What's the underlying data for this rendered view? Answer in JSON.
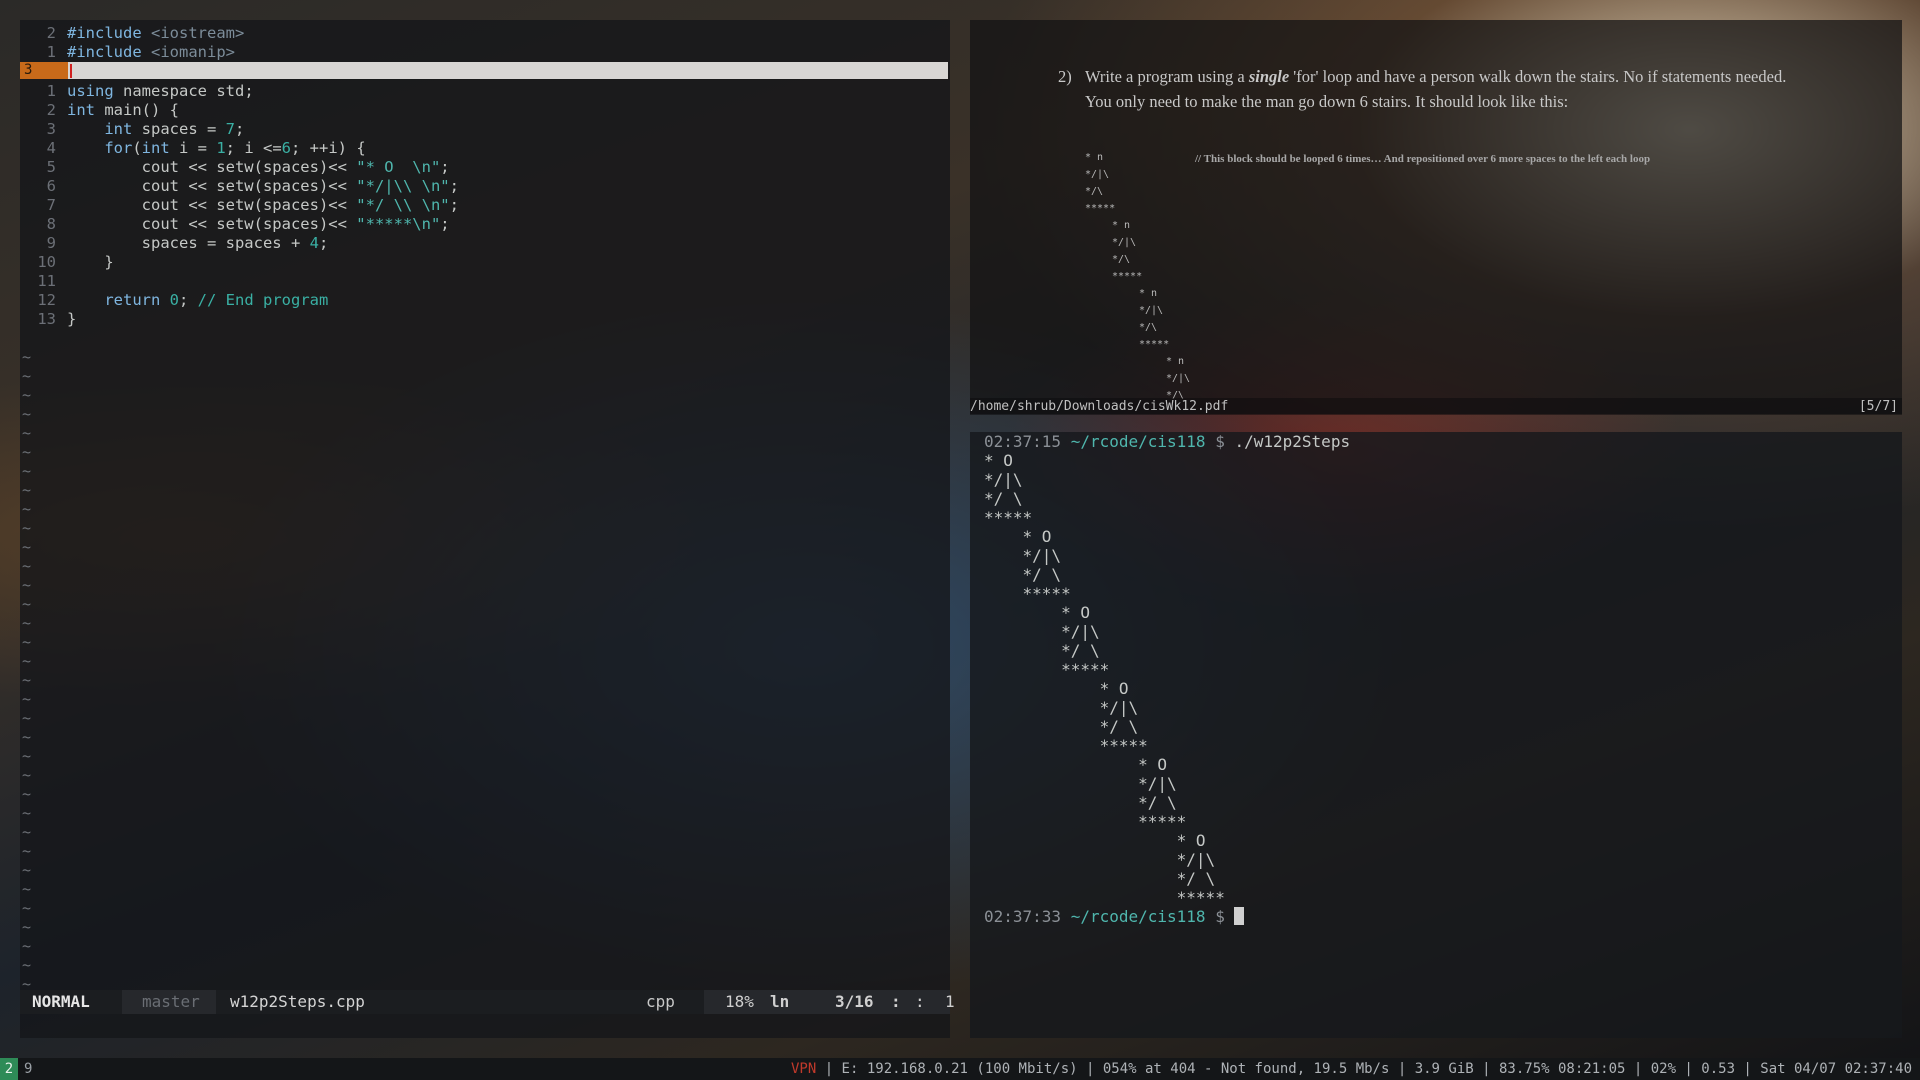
{
  "editor": {
    "tilde": "~",
    "lines": [
      {
        "num": "2",
        "parts": [
          [
            "inc-kw",
            "#include "
          ],
          [
            "inc",
            "<iostream>"
          ]
        ]
      },
      {
        "num": "1",
        "parts": [
          [
            "inc-kw",
            "#include "
          ],
          [
            "inc",
            "<iomanip>"
          ]
        ]
      },
      {
        "num": "3",
        "parts": []
      },
      {
        "num": "1",
        "parts": [
          [
            "kw",
            "using "
          ],
          [
            "plain",
            "namespace std;"
          ]
        ]
      },
      {
        "num": "2",
        "parts": [
          [
            "type",
            "int "
          ],
          [
            "plain",
            "main() {"
          ]
        ]
      },
      {
        "num": "3",
        "parts": [
          [
            "plain",
            "    "
          ],
          [
            "type",
            "int "
          ],
          [
            "plain",
            "spaces = "
          ],
          [
            "num",
            "7"
          ],
          [
            "plain",
            ";"
          ]
        ]
      },
      {
        "num": "4",
        "parts": [
          [
            "plain",
            "    "
          ],
          [
            "kw",
            "for"
          ],
          [
            "plain",
            "("
          ],
          [
            "type",
            "int "
          ],
          [
            "plain",
            "i = "
          ],
          [
            "num",
            "1"
          ],
          [
            "plain",
            "; i <="
          ],
          [
            "num",
            "6"
          ],
          [
            "plain",
            "; ++i) {"
          ]
        ]
      },
      {
        "num": "5",
        "parts": [
          [
            "plain",
            "        cout << setw(spaces)<< "
          ],
          [
            "str",
            "\"* O  \\n\""
          ],
          [
            "plain",
            ";"
          ]
        ]
      },
      {
        "num": "6",
        "parts": [
          [
            "plain",
            "        cout << setw(spaces)<< "
          ],
          [
            "str",
            "\"*/|\\\\ \\n\""
          ],
          [
            "plain",
            ";"
          ]
        ]
      },
      {
        "num": "7",
        "parts": [
          [
            "plain",
            "        cout << setw(spaces)<< "
          ],
          [
            "str",
            "\"*/ \\\\ \\n\""
          ],
          [
            "plain",
            ";"
          ]
        ]
      },
      {
        "num": "8",
        "parts": [
          [
            "plain",
            "        cout << setw(spaces)<< "
          ],
          [
            "str",
            "\"*****\\n\""
          ],
          [
            "plain",
            ";"
          ]
        ]
      },
      {
        "num": "9",
        "parts": [
          [
            "plain",
            "        spaces = spaces + "
          ],
          [
            "num",
            "4"
          ],
          [
            "plain",
            ";"
          ]
        ]
      },
      {
        "num": "10",
        "parts": [
          [
            "plain",
            "    }"
          ]
        ]
      },
      {
        "num": "11",
        "parts": []
      },
      {
        "num": "12",
        "parts": [
          [
            "plain",
            "    "
          ],
          [
            "kw",
            "return "
          ],
          [
            "num",
            "0"
          ],
          [
            "plain",
            "; "
          ],
          [
            "com",
            "// End program"
          ]
        ]
      },
      {
        "num": "13",
        "parts": [
          [
            "plain",
            "}"
          ]
        ]
      }
    ],
    "status": {
      "mode": "NORMAL",
      "branch": "master",
      "filename": "w12p2Steps.cpp",
      "filetype": "cpp",
      "percent": "18%",
      "ln": "ln",
      "position": "3/16",
      "sep1": ":",
      "sep2": ":",
      "col": "1"
    }
  },
  "pdf": {
    "line1_num": "2)",
    "line1_a": "Write a program using a ",
    "line1_em": "single",
    "line1_b": " 'for' loop and have a person walk down the stairs.  No if statements needed.",
    "line2": "You only need to make the man go down 6 stairs.  It should look like this:",
    "comment": "// This block should be looped 6 times… And repositioned over 6 more spaces to the left each loop",
    "figure": [
      "* n",
      "*/|\\",
      "*/\\",
      "*****",
      "* n",
      "*/|\\",
      "*/\\",
      "*****",
      "* n",
      "*/|\\",
      "*/\\",
      "*****",
      "* n",
      "*/|\\",
      "*/\\"
    ],
    "path": "/home/shrub/Downloads/cisWk12.pdf",
    "page": "[5/7]"
  },
  "terminal": {
    "prompt1": {
      "time": "02:37:15",
      "path": "~/rcode/cis118",
      "dollar": "$",
      "cmd": "./w12p2Steps"
    },
    "output": [
      "* O",
      "*/|\\",
      "*/ \\",
      "*****",
      "    * O",
      "    */|\\",
      "    */ \\",
      "    *****",
      "        * O",
      "        */|\\",
      "        */ \\",
      "        *****",
      "            * O",
      "            */|\\",
      "            */ \\",
      "            *****",
      "                * O",
      "                */|\\",
      "                */ \\",
      "                *****",
      "                    * O",
      "                    */|\\",
      "                    */ \\",
      "                    *****"
    ],
    "prompt2": {
      "time": "02:37:33",
      "path": "~/rcode/cis118",
      "dollar": "$"
    }
  },
  "bar": {
    "workspace_active": "2",
    "workspace_other": "9",
    "vpn": "VPN",
    "info": " | E: 192.168.0.21 (100 Mbit/s) | 054% at 404 - Not found, 19.5 Mb/s | 3.9 GiB | 83.75% 08:21:05 | 02% | 0.53 | Sat 04/07 02:37:40"
  }
}
